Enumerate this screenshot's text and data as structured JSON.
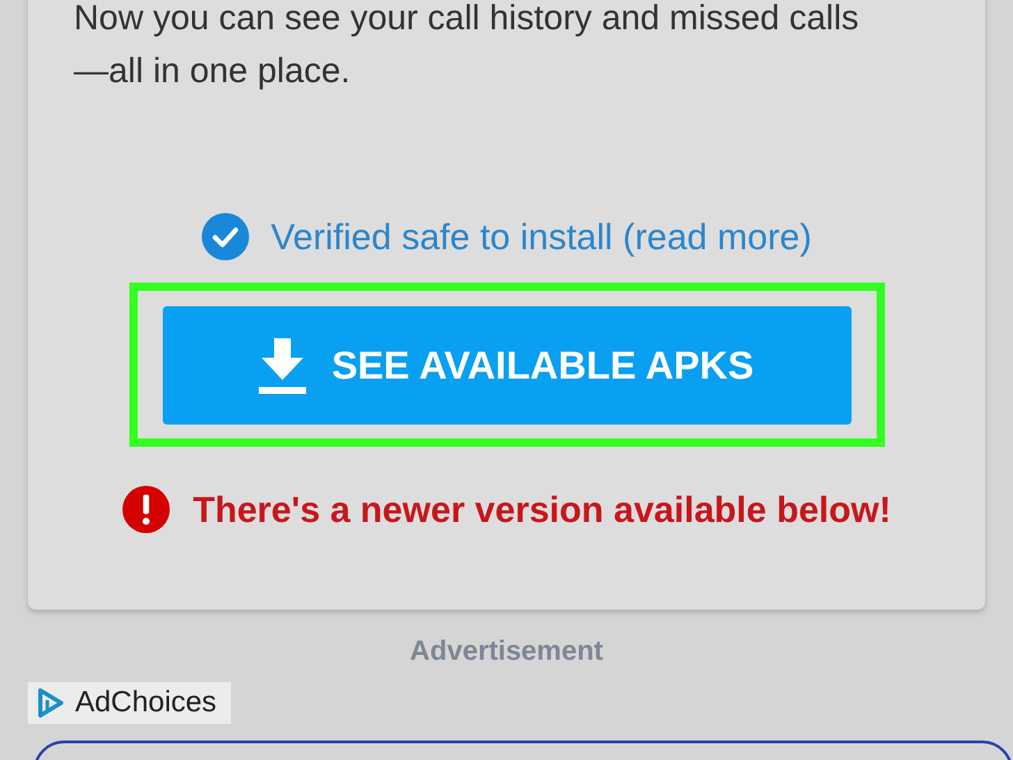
{
  "description": "Now you can see your call history and missed calls—all in one place.",
  "verified": {
    "label": "Verified safe to install (read more)"
  },
  "download_button": {
    "label": "SEE AVAILABLE APKS",
    "highlighted": true
  },
  "warning": {
    "label": "There's a newer version available below!"
  },
  "ad": {
    "label": "Advertisement",
    "adchoices": "AdChoices"
  }
}
